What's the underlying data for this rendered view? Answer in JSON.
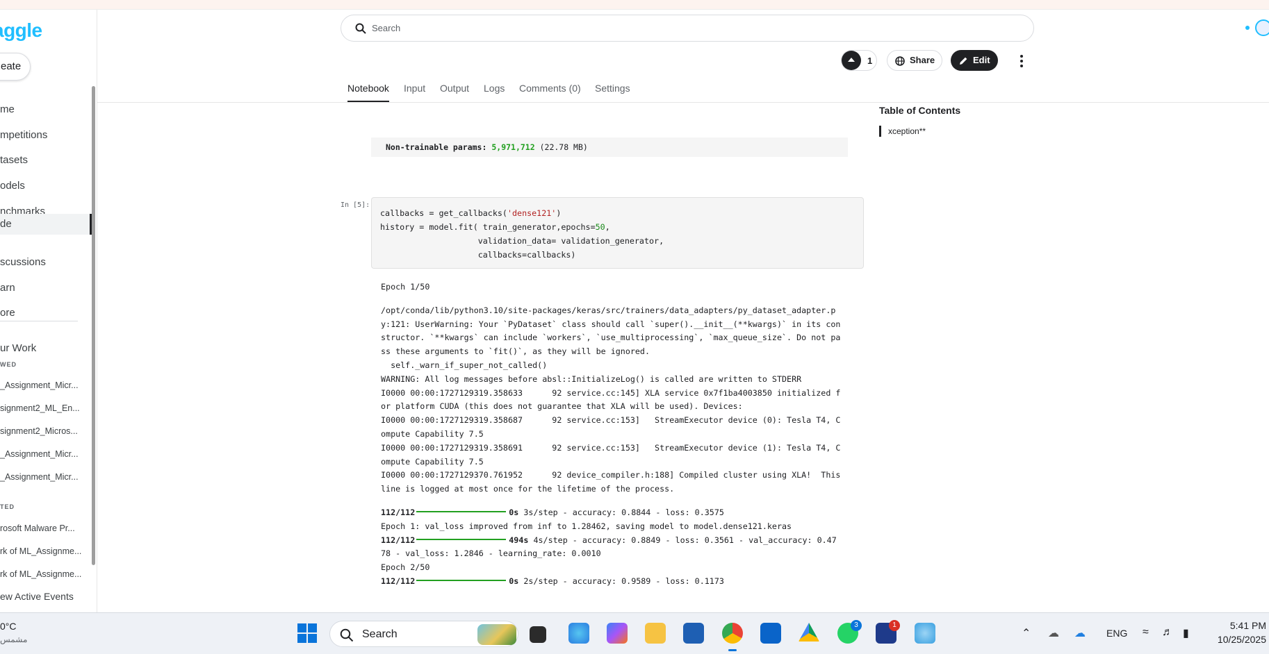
{
  "sidebar": {
    "logo": "aggle",
    "create_label": "eate",
    "nav": [
      "me",
      "mpetitions",
      "tasets",
      "odels",
      "nchmarks",
      "de",
      "scussions",
      "arn",
      "ore"
    ],
    "your_work": "ur Work",
    "viewed_head": "WED",
    "viewed": [
      "_Assignment_Micr...",
      "signment2_ML_En...",
      "signment2_Micros...",
      "_Assignment_Micr...",
      "_Assignment_Micr..."
    ],
    "edited_head": "TED",
    "edited": [
      "rosoft Malware Pr...",
      "rk of ML_Assignme...",
      "rk of ML_Assignme..."
    ],
    "view_events": "ew Active Events"
  },
  "header": {
    "search_placeholder": "Search",
    "vote_count": "1",
    "share_label": "Share",
    "edit_label": "Edit"
  },
  "tabs": [
    "Notebook",
    "Input",
    "Output",
    "Logs",
    "Comments (0)",
    "Settings"
  ],
  "toc": {
    "title": "Table of Contents",
    "item": "xception**"
  },
  "notebook": {
    "params_label": "Non-trainable params:",
    "params_value": "5,971,712",
    "params_size": "(22.78 MB)",
    "prompt": "In [5]:",
    "code": {
      "l1a": "callbacks = get_callbacks(",
      "l1s": "'dense121'",
      "l1b": ")",
      "l2a": "history = model.fit( train_generator,epochs=",
      "l2n": "50",
      "l2b": ",",
      "l3": "                    validation_data= validation_generator,",
      "l4": "                    callbacks=callbacks)"
    },
    "output": {
      "epoch1": "Epoch 1/50",
      "log": [
        "/opt/conda/lib/python3.10/site-packages/keras/src/trainers/data_adapters/py_dataset_adapter.p",
        "y:121: UserWarning: Your `PyDataset` class should call `super().__init__(**kwargs)` in its con",
        "structor. `**kwargs` can include `workers`, `use_multiprocessing`, `max_queue_size`. Do not pa",
        "ss these arguments to `fit()`, as they will be ignored.",
        "  self._warn_if_super_not_called()",
        "WARNING: All log messages before absl::InitializeLog() is called are written to STDERR",
        "I0000 00:00:1727129319.358633      92 service.cc:145] XLA service 0x7f1ba4003850 initialized f",
        "or platform CUDA (this does not guarantee that XLA will be used). Devices:",
        "I0000 00:00:1727129319.358687      92 service.cc:153]   StreamExecutor device (0): Tesla T4, C",
        "ompute Capability 7.5",
        "I0000 00:00:1727129319.358691      92 service.cc:153]   StreamExecutor device (1): Tesla T4, C",
        "ompute Capability 7.5",
        "I0000 00:00:1727129370.761952      92 device_compiler.h:188] Compiled cluster using XLA!  This",
        "line is logged at most once for the lifetime of the process."
      ],
      "p1_steps": "112/112",
      "p1_time": "0s",
      "p1_rest": "3s/step - accuracy: 0.8844 - loss: 0.3575",
      "improved": "Epoch 1: val_loss improved from inf to 1.28462, saving model to model.dense121.keras",
      "p2_steps": "112/112",
      "p2_time": "494s",
      "p2_rest": "4s/step - accuracy: 0.8849 - loss: 0.3561 - val_accuracy: 0.47",
      "p2_cont": "78 - val_loss: 1.2846 - learning_rate: 0.0010",
      "epoch2": "Epoch 2/50",
      "p3_steps": "112/112",
      "p3_time": "0s",
      "p3_rest": "2s/step - accuracy: 0.9589 - loss: 0.1173"
    }
  },
  "taskbar": {
    "weather_temp": "0°C",
    "weather_desc": "مشمس",
    "search_label": "Search",
    "badge_whatsapp": "3",
    "badge_app": "1",
    "lang": "ENG",
    "time": "5:41 PM",
    "date": "10/25/2025"
  },
  "colors": {
    "kaggle_blue": "#20beff",
    "number_green": "#22a020",
    "string_red": "#b22222"
  }
}
